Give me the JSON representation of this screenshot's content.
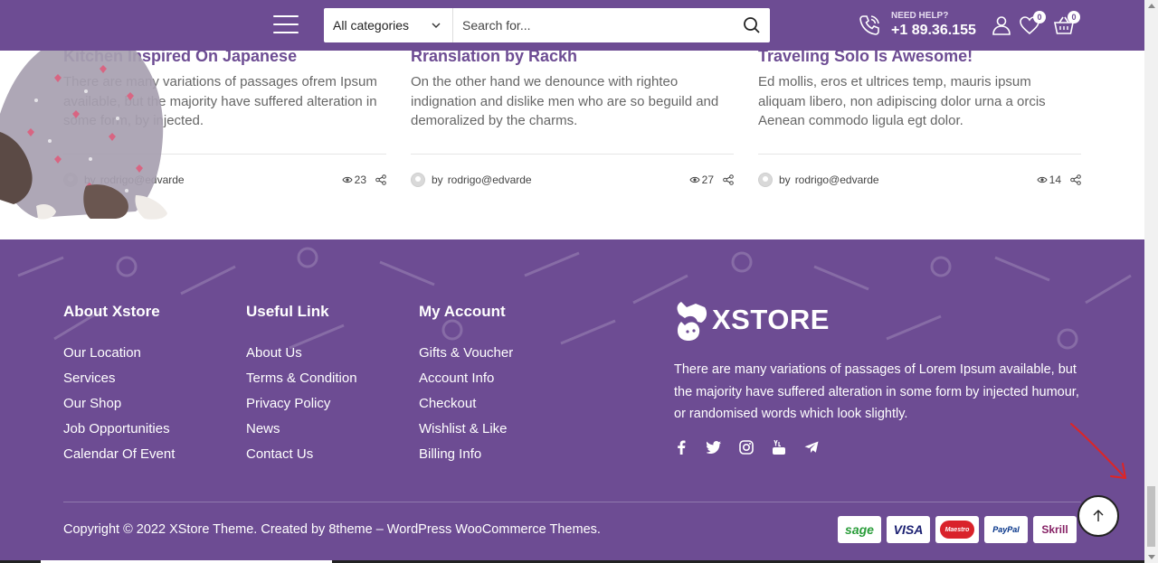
{
  "header": {
    "category": "All categories",
    "search_placeholder": "Search for...",
    "help_label": "NEED HELP?",
    "phone": "+1 89.36.155",
    "wishlist_count": "0",
    "cart_count": "0"
  },
  "posts": [
    {
      "title": "Kitchen Inspired On Japanese",
      "excerpt": "There are many variations of passages ofrem Ipsum available, but the majority have suffered alteration in some form, by injected.",
      "by": "by",
      "author": "rodrigo@edvarde",
      "views": "23"
    },
    {
      "title": "Rranslation by Rackh",
      "excerpt": "On the other hand we denounce with righteo indignation and dislike men who are so beguild and demoralized by the charms.",
      "by": "by",
      "author": "rodrigo@edvarde",
      "views": "27"
    },
    {
      "title": "Traveling Solo Is Awesome!",
      "excerpt": "Ed mollis, eros et ultrices temp, mauris ipsum aliquam libero, non adipiscing dolor urna a orcis Aenean commodo ligula egt dolor.",
      "by": "by",
      "author": "rodrigo@edvarde",
      "views": "14"
    }
  ],
  "footer": {
    "about": {
      "title": "About Xstore",
      "links": [
        "Our Location",
        "Services",
        "Our Shop",
        "Job Opportunities",
        "Calendar Of Event"
      ]
    },
    "useful": {
      "title": "Useful Link",
      "links": [
        "About Us",
        "Terms & Condition",
        "Privacy Policy",
        "News",
        "Contact Us"
      ]
    },
    "account": {
      "title": "My Account",
      "links": [
        "Gifts & Voucher",
        "Account Info",
        "Checkout",
        "Wishlist & Like",
        "Billing Info"
      ]
    },
    "brand": "XSTORE",
    "description": "There are many variations of passages of Lorem Ipsum available, but the majority have suffered alteration in some form by injected humour, or randomised words which look slightly.",
    "socials": [
      "facebook-icon",
      "twitter-icon",
      "instagram-icon",
      "youtube-icon",
      "telegram-icon"
    ],
    "copyright": "Copyright © 2022 XStore Theme. Created by 8theme – WordPress WooCommerce Themes.",
    "payments": [
      "sage",
      "VISA",
      "Maestro",
      "PayPal",
      "Skrill"
    ]
  },
  "colors": {
    "brand": "#6d4c93",
    "annotation": "#e02424"
  }
}
